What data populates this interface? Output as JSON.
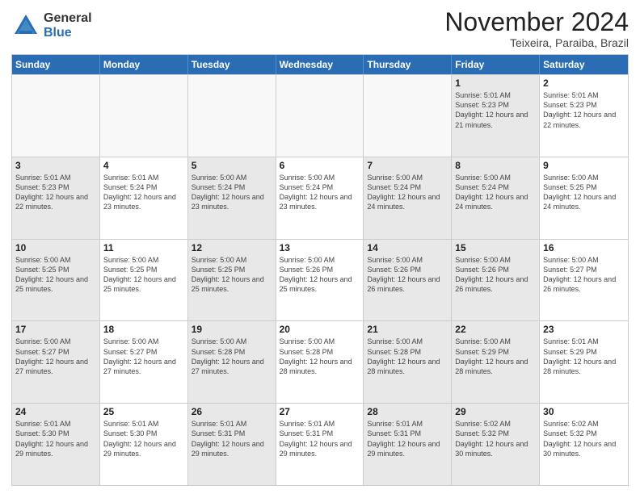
{
  "header": {
    "logo_general": "General",
    "logo_blue": "Blue",
    "month_title": "November 2024",
    "location": "Teixeira, Paraiba, Brazil"
  },
  "weekdays": [
    "Sunday",
    "Monday",
    "Tuesday",
    "Wednesday",
    "Thursday",
    "Friday",
    "Saturday"
  ],
  "rows": [
    [
      {
        "day": "",
        "empty": true
      },
      {
        "day": "",
        "empty": true
      },
      {
        "day": "",
        "empty": true
      },
      {
        "day": "",
        "empty": true
      },
      {
        "day": "",
        "empty": true
      },
      {
        "day": "1",
        "sunrise": "5:01 AM",
        "sunset": "5:23 PM",
        "daylight": "12 hours and 21 minutes.",
        "shaded": true
      },
      {
        "day": "2",
        "sunrise": "5:01 AM",
        "sunset": "5:23 PM",
        "daylight": "12 hours and 22 minutes."
      }
    ],
    [
      {
        "day": "3",
        "sunrise": "5:01 AM",
        "sunset": "5:23 PM",
        "daylight": "12 hours and 22 minutes.",
        "shaded": true
      },
      {
        "day": "4",
        "sunrise": "5:01 AM",
        "sunset": "5:24 PM",
        "daylight": "12 hours and 23 minutes."
      },
      {
        "day": "5",
        "sunrise": "5:00 AM",
        "sunset": "5:24 PM",
        "daylight": "12 hours and 23 minutes.",
        "shaded": true
      },
      {
        "day": "6",
        "sunrise": "5:00 AM",
        "sunset": "5:24 PM",
        "daylight": "12 hours and 23 minutes."
      },
      {
        "day": "7",
        "sunrise": "5:00 AM",
        "sunset": "5:24 PM",
        "daylight": "12 hours and 24 minutes.",
        "shaded": true
      },
      {
        "day": "8",
        "sunrise": "5:00 AM",
        "sunset": "5:24 PM",
        "daylight": "12 hours and 24 minutes.",
        "shaded": true
      },
      {
        "day": "9",
        "sunrise": "5:00 AM",
        "sunset": "5:25 PM",
        "daylight": "12 hours and 24 minutes."
      }
    ],
    [
      {
        "day": "10",
        "sunrise": "5:00 AM",
        "sunset": "5:25 PM",
        "daylight": "12 hours and 25 minutes.",
        "shaded": true
      },
      {
        "day": "11",
        "sunrise": "5:00 AM",
        "sunset": "5:25 PM",
        "daylight": "12 hours and 25 minutes."
      },
      {
        "day": "12",
        "sunrise": "5:00 AM",
        "sunset": "5:25 PM",
        "daylight": "12 hours and 25 minutes.",
        "shaded": true
      },
      {
        "day": "13",
        "sunrise": "5:00 AM",
        "sunset": "5:26 PM",
        "daylight": "12 hours and 25 minutes."
      },
      {
        "day": "14",
        "sunrise": "5:00 AM",
        "sunset": "5:26 PM",
        "daylight": "12 hours and 26 minutes.",
        "shaded": true
      },
      {
        "day": "15",
        "sunrise": "5:00 AM",
        "sunset": "5:26 PM",
        "daylight": "12 hours and 26 minutes.",
        "shaded": true
      },
      {
        "day": "16",
        "sunrise": "5:00 AM",
        "sunset": "5:27 PM",
        "daylight": "12 hours and 26 minutes."
      }
    ],
    [
      {
        "day": "17",
        "sunrise": "5:00 AM",
        "sunset": "5:27 PM",
        "daylight": "12 hours and 27 minutes.",
        "shaded": true
      },
      {
        "day": "18",
        "sunrise": "5:00 AM",
        "sunset": "5:27 PM",
        "daylight": "12 hours and 27 minutes."
      },
      {
        "day": "19",
        "sunrise": "5:00 AM",
        "sunset": "5:28 PM",
        "daylight": "12 hours and 27 minutes.",
        "shaded": true
      },
      {
        "day": "20",
        "sunrise": "5:00 AM",
        "sunset": "5:28 PM",
        "daylight": "12 hours and 28 minutes."
      },
      {
        "day": "21",
        "sunrise": "5:00 AM",
        "sunset": "5:28 PM",
        "daylight": "12 hours and 28 minutes.",
        "shaded": true
      },
      {
        "day": "22",
        "sunrise": "5:00 AM",
        "sunset": "5:29 PM",
        "daylight": "12 hours and 28 minutes.",
        "shaded": true
      },
      {
        "day": "23",
        "sunrise": "5:01 AM",
        "sunset": "5:29 PM",
        "daylight": "12 hours and 28 minutes."
      }
    ],
    [
      {
        "day": "24",
        "sunrise": "5:01 AM",
        "sunset": "5:30 PM",
        "daylight": "12 hours and 29 minutes.",
        "shaded": true
      },
      {
        "day": "25",
        "sunrise": "5:01 AM",
        "sunset": "5:30 PM",
        "daylight": "12 hours and 29 minutes."
      },
      {
        "day": "26",
        "sunrise": "5:01 AM",
        "sunset": "5:31 PM",
        "daylight": "12 hours and 29 minutes.",
        "shaded": true
      },
      {
        "day": "27",
        "sunrise": "5:01 AM",
        "sunset": "5:31 PM",
        "daylight": "12 hours and 29 minutes."
      },
      {
        "day": "28",
        "sunrise": "5:01 AM",
        "sunset": "5:31 PM",
        "daylight": "12 hours and 29 minutes.",
        "shaded": true
      },
      {
        "day": "29",
        "sunrise": "5:02 AM",
        "sunset": "5:32 PM",
        "daylight": "12 hours and 30 minutes.",
        "shaded": true
      },
      {
        "day": "30",
        "sunrise": "5:02 AM",
        "sunset": "5:32 PM",
        "daylight": "12 hours and 30 minutes."
      }
    ]
  ]
}
